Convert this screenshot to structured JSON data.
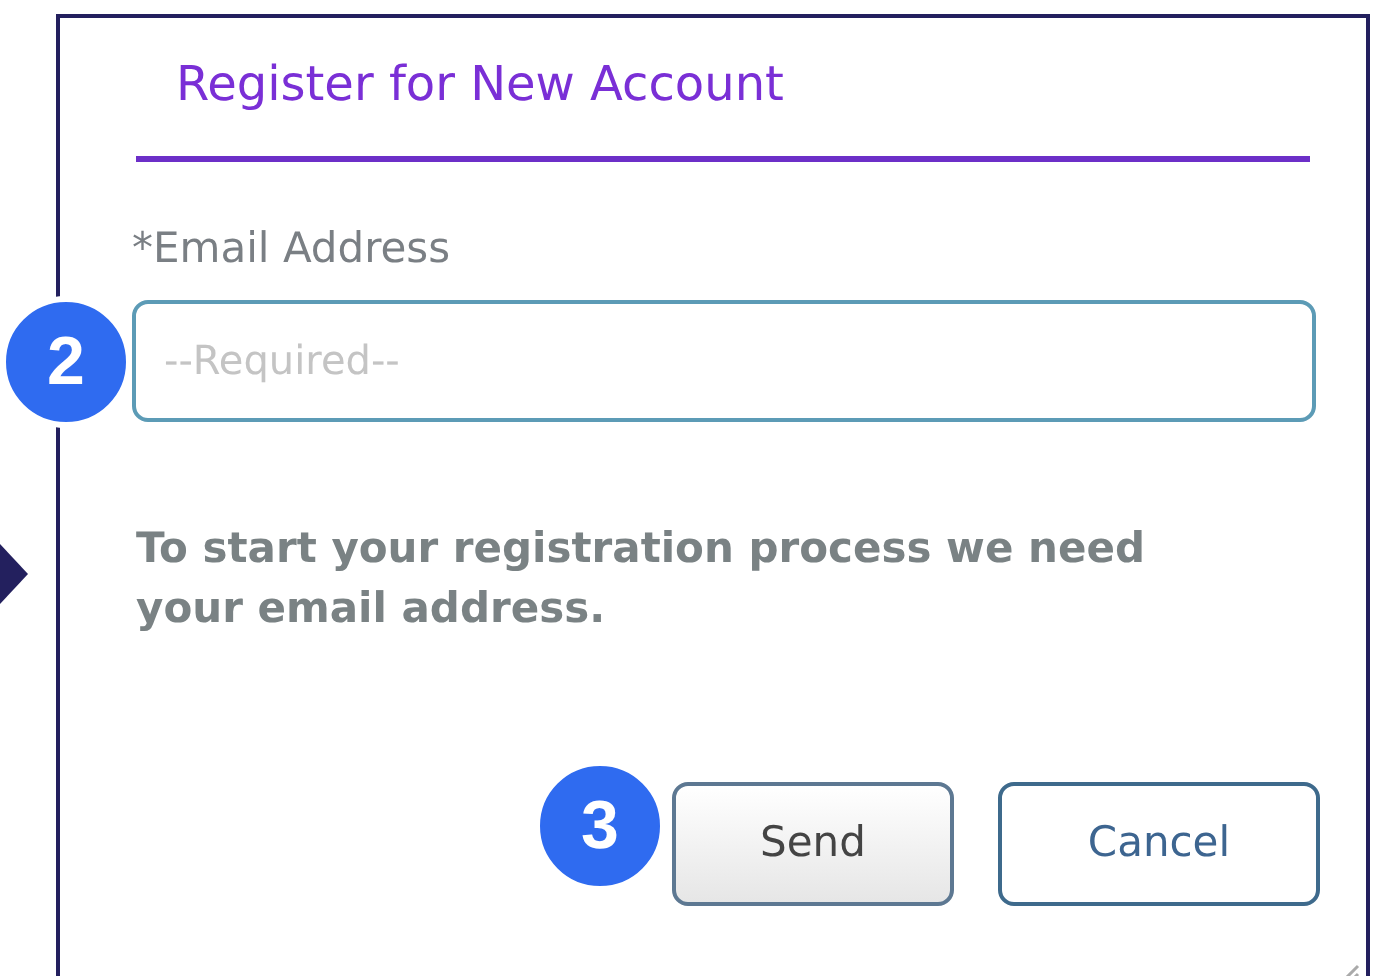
{
  "dialog": {
    "title": "Register for New Account",
    "email_field": {
      "label": "*Email Address",
      "placeholder": "--Required--"
    },
    "message": "To start your registration process we need your email address.",
    "buttons": [
      {
        "label": "Send",
        "kind": "default"
      },
      {
        "label": "Cancel",
        "kind": "outline"
      }
    ]
  },
  "callouts": [
    {
      "label": "2",
      "kind": "field"
    },
    {
      "label": "3",
      "kind": "button"
    }
  ]
}
